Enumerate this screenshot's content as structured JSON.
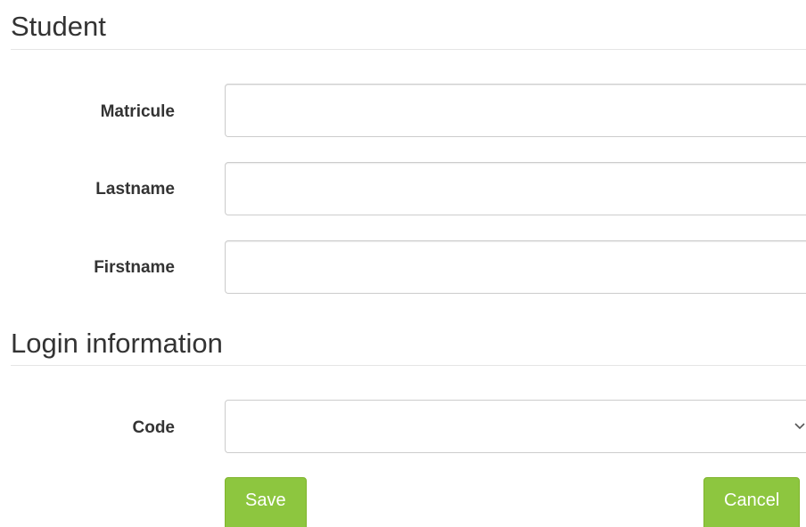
{
  "student_section": {
    "title": "Student",
    "fields": {
      "matricule": {
        "label": "Matricule",
        "value": ""
      },
      "lastname": {
        "label": "Lastname",
        "value": ""
      },
      "firstname": {
        "label": "Firstname",
        "value": ""
      }
    }
  },
  "login_section": {
    "title": "Login information",
    "fields": {
      "code": {
        "label": "Code",
        "selected": "",
        "icon": "chevron-down-icon"
      }
    }
  },
  "actions": {
    "save_label": "Save",
    "cancel_label": "Cancel"
  },
  "colors": {
    "button_green": "#8dc63f",
    "input_border": "#cccccc",
    "divider": "#e5e5e5",
    "text": "#333333"
  }
}
